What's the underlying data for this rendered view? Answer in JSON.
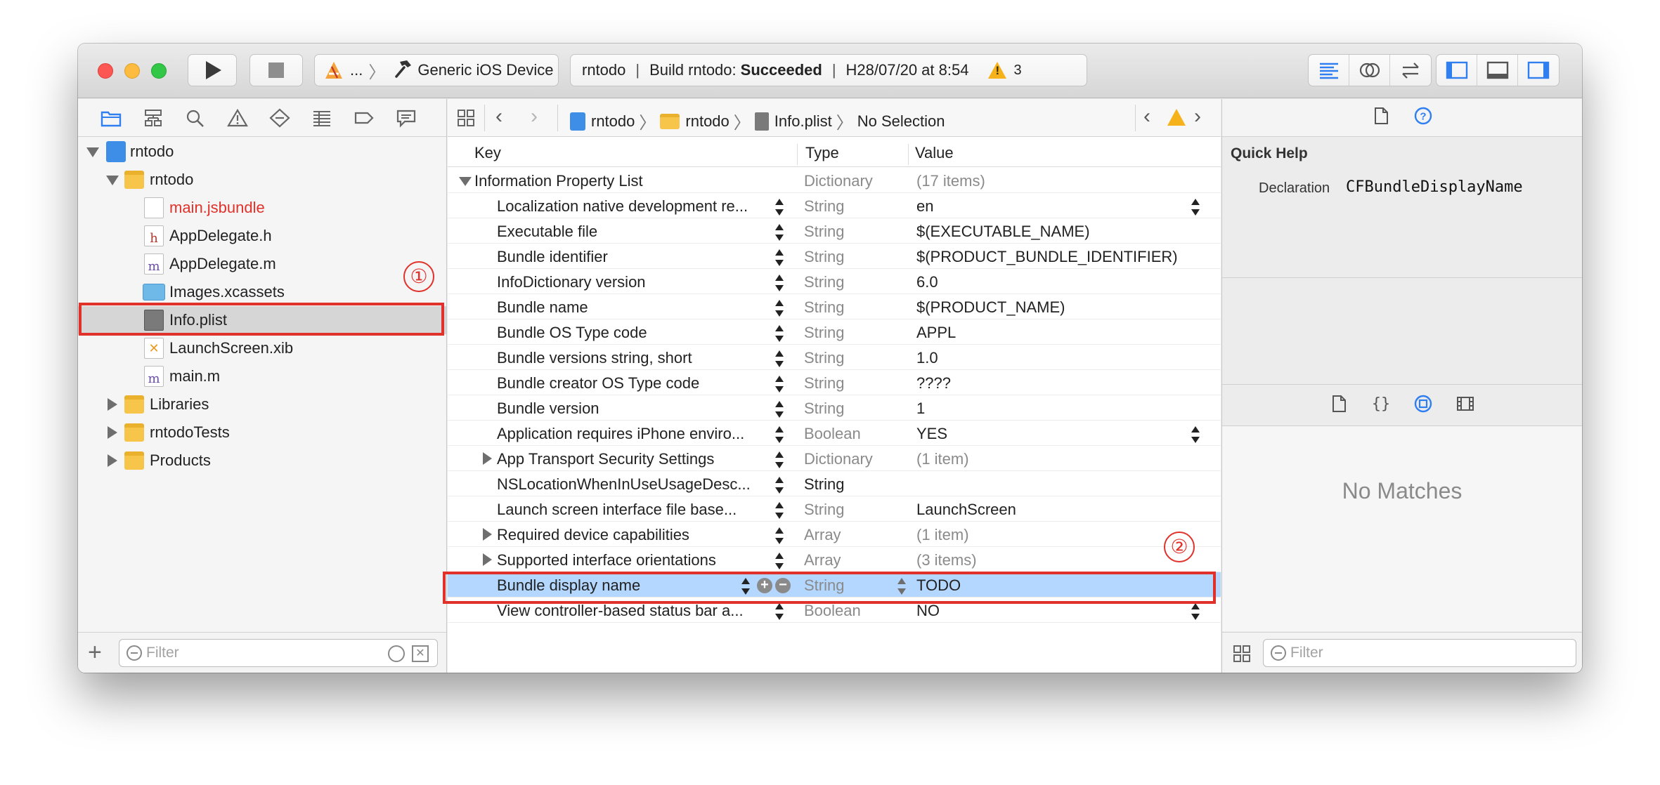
{
  "toolbar": {
    "scheme_ellipsis": "...",
    "scheme_device": "Generic iOS Device",
    "activity_project": "rntodo",
    "activity_build_prefix": "Build rntodo:",
    "activity_build_status": "Succeeded",
    "activity_timestamp": "H28/07/20 at 8:54",
    "warning_count": "3",
    "warning_color": "#f5b21b"
  },
  "navigator": {
    "items": [
      {
        "label": "rntodo"
      },
      {
        "label": "rntodo"
      },
      {
        "label": "main.jsbundle"
      },
      {
        "label": "AppDelegate.h"
      },
      {
        "label": "AppDelegate.m"
      },
      {
        "label": "Images.xcassets"
      },
      {
        "label": "Info.plist"
      },
      {
        "label": "LaunchScreen.xib"
      },
      {
        "label": "main.m"
      },
      {
        "label": "Libraries"
      },
      {
        "label": "rntodoTests"
      },
      {
        "label": "Products"
      }
    ],
    "missing_file_color": "#e0322b",
    "filter_placeholder": "Filter"
  },
  "jumpbar": {
    "crumbs": [
      "rntodo",
      "rntodo",
      "Info.plist",
      "No Selection"
    ]
  },
  "plist": {
    "headers": {
      "key": "Key",
      "type": "Type",
      "value": "Value"
    },
    "root": {
      "key": "Information Property List",
      "type": "Dictionary",
      "value": "(17 items)"
    },
    "rows": [
      {
        "key": "Localization native development re...",
        "type": "String",
        "value": "en"
      },
      {
        "key": "Executable file",
        "type": "String",
        "value": "$(EXECUTABLE_NAME)"
      },
      {
        "key": "Bundle identifier",
        "type": "String",
        "value": "$(PRODUCT_BUNDLE_IDENTIFIER)"
      },
      {
        "key": "InfoDictionary version",
        "type": "String",
        "value": "6.0"
      },
      {
        "key": "Bundle name",
        "type": "String",
        "value": "$(PRODUCT_NAME)"
      },
      {
        "key": "Bundle OS Type code",
        "type": "String",
        "value": "APPL"
      },
      {
        "key": "Bundle versions string, short",
        "type": "String",
        "value": "1.0"
      },
      {
        "key": "Bundle creator OS Type code",
        "type": "String",
        "value": "????"
      },
      {
        "key": "Bundle version",
        "type": "String",
        "value": "1"
      },
      {
        "key": "Application requires iPhone enviro...",
        "type": "Boolean",
        "value": "YES"
      },
      {
        "key": "App Transport Security Settings",
        "type": "Dictionary",
        "value": "(1 item)"
      },
      {
        "key": "NSLocationWhenInUseUsageDesc...",
        "type": "String",
        "value": ""
      },
      {
        "key": "Launch screen interface file base...",
        "type": "String",
        "value": "LaunchScreen"
      },
      {
        "key": "Required device capabilities",
        "type": "Array",
        "value": "(1 item)"
      },
      {
        "key": "Supported interface orientations",
        "type": "Array",
        "value": "(3 items)"
      },
      {
        "key": "Bundle display name",
        "type": "String",
        "value": "TODO"
      },
      {
        "key": "View controller-based status bar a...",
        "type": "Boolean",
        "value": "NO"
      }
    ],
    "selection_color": "#b3d7ff"
  },
  "inspector": {
    "quick_help_title": "Quick Help",
    "declaration_label": "Declaration",
    "declaration_value": "CFBundleDisplayName",
    "library_empty_text": "No Matches",
    "filter_placeholder": "Filter"
  },
  "annotations": {
    "marker_1": "①",
    "marker_2": "②",
    "color": "#e0322b"
  }
}
